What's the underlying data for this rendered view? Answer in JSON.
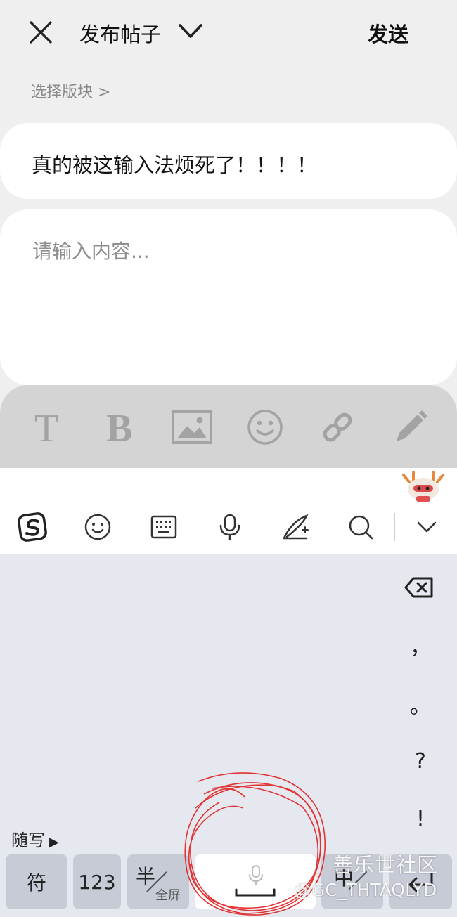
{
  "header": {
    "title": "发布帖子",
    "send_label": "发送"
  },
  "section_selector": "选择版块 >",
  "post": {
    "title_value": "真的被这输入法烦死了！！！！",
    "content_placeholder": "请输入内容..."
  },
  "toolbar": {
    "text_label": "T",
    "bold_label": "B"
  },
  "keyboard": {
    "punctuation": [
      "，",
      "。",
      "?",
      "!"
    ],
    "suixie_label": "随写",
    "keys": {
      "symbol": "符",
      "numeric": "123",
      "half": "半",
      "fullscreen": "全屏",
      "chinese": "中"
    }
  },
  "watermark": {
    "line1": "善乐世社区",
    "line2": "@GC_THTAQLYD"
  },
  "annotation": {
    "color": "#e02020"
  },
  "colors": {
    "keyboard_bg": "#e6e8ef",
    "toolbar_bg": "#d4d4d4",
    "key_bg": "#c7cbd6"
  }
}
